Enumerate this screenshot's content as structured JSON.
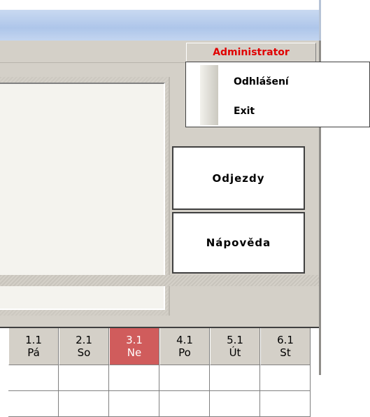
{
  "menu": {
    "header": "Administrator",
    "items": [
      "Odhlášení",
      "Exit"
    ]
  },
  "buttons": {
    "departures": "Odjezdy",
    "help": "Nápověda"
  },
  "calendar": {
    "columns": [
      {
        "date": "1.1",
        "day": "Pá"
      },
      {
        "date": "2.1",
        "day": "So"
      },
      {
        "date": "3.1",
        "day": "Ne"
      },
      {
        "date": "4.1",
        "day": "Po"
      },
      {
        "date": "5.1",
        "day": "Út"
      },
      {
        "date": "6.1",
        "day": "St"
      }
    ],
    "today_color": "#d05c5c"
  },
  "colors": {
    "menu_header_text": "#e00000",
    "window_face": "#d4d0c8"
  }
}
